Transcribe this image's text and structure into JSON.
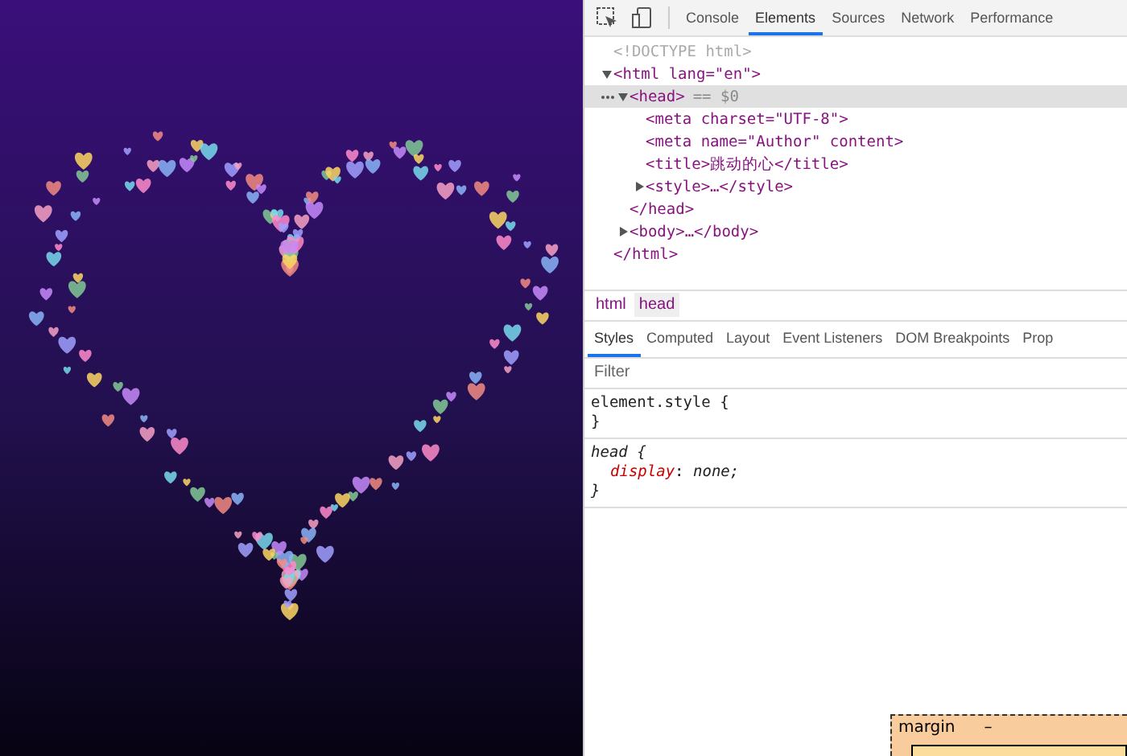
{
  "toolbar": {
    "tabs": [
      {
        "label": "Console",
        "selected": false
      },
      {
        "label": "Elements",
        "selected": true
      },
      {
        "label": "Sources",
        "selected": false
      },
      {
        "label": "Network",
        "selected": false
      },
      {
        "label": "Performance",
        "selected": false
      }
    ]
  },
  "dom_tree": [
    {
      "kind": "doctype",
      "text": "<!DOCTYPE html>",
      "selected": false
    },
    {
      "kind": "element",
      "text": "<html lang=\"en\">",
      "selected": false,
      "expanded": true,
      "close": "</html>",
      "children": [
        {
          "kind": "element",
          "text": "<head>",
          "suffix": "== $0",
          "selected": true,
          "expanded": true,
          "close": "</head>",
          "children": [
            {
              "kind": "leaf",
              "text": "<meta charset=\"UTF-8\">",
              "selected": false
            },
            {
              "kind": "leaf",
              "text": "<meta name=\"Author\" content>",
              "selected": false
            },
            {
              "kind": "leaf",
              "text": "<title>跳动的心</title>",
              "selected": false
            },
            {
              "kind": "element",
              "text": "<style>…</style>",
              "selected": false,
              "expanded": false
            }
          ]
        },
        {
          "kind": "element",
          "text": "<body>…</body>",
          "selected": false,
          "expanded": false
        }
      ]
    }
  ],
  "breadcrumb": [
    {
      "label": "html",
      "selected": false
    },
    {
      "label": "head",
      "selected": true
    }
  ],
  "styles_tabs": [
    {
      "label": "Styles",
      "selected": true
    },
    {
      "label": "Computed",
      "selected": false
    },
    {
      "label": "Layout",
      "selected": false
    },
    {
      "label": "Event Listeners",
      "selected": false
    },
    {
      "label": "DOM Breakpoints",
      "selected": false
    },
    {
      "label": "Prop",
      "selected": false
    }
  ],
  "filter": {
    "placeholder": "Filter"
  },
  "rules": [
    {
      "selector": "element.style {",
      "kind": "inline",
      "close": "}"
    },
    {
      "selector": "head {",
      "kind": "user-agent",
      "declarations": [
        {
          "property": "display",
          "separator": ":",
          "value": "none;"
        }
      ],
      "close": "}"
    }
  ],
  "box_model": {
    "label": "margin",
    "value": "–"
  }
}
